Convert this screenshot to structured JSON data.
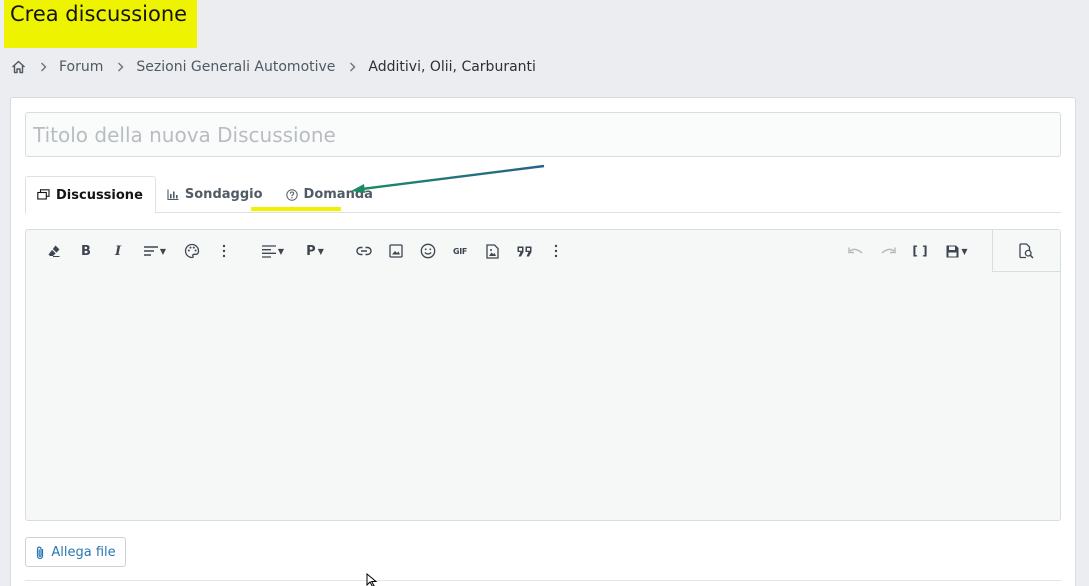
{
  "page": {
    "title": "Crea discussione"
  },
  "breadcrumb": {
    "items": [
      "Forum",
      "Sezioni Generali Automotive",
      "Additivi, Olii, Carburanti"
    ]
  },
  "form": {
    "title_placeholder": "Titolo della nuova Discussione",
    "tabs": [
      {
        "label": "Discussione",
        "icon": "discussion-icon",
        "active": true
      },
      {
        "label": "Sondaggio",
        "icon": "poll-icon",
        "active": false
      },
      {
        "label": "Domanda",
        "icon": "question-icon",
        "active": false
      }
    ],
    "attach_label": "Allega file"
  },
  "toolbar": {
    "left_buttons": [
      "eraser-icon",
      "bold-icon",
      "italic-icon",
      "text-size-icon",
      "palette-icon",
      "more-icon",
      "align-icon",
      "paragraph-icon",
      "link-icon",
      "image-icon",
      "smiley-icon",
      "gif-icon",
      "media-icon",
      "quote-icon",
      "more-icon"
    ],
    "bold_label": "B",
    "italic_label": "I",
    "paragraph_label": "P",
    "gif_label": "GIF",
    "bbcode_label": "[ ]"
  },
  "annotation": {
    "highlight_color": "#eef400",
    "arrow_color": "#1b7a6b"
  }
}
